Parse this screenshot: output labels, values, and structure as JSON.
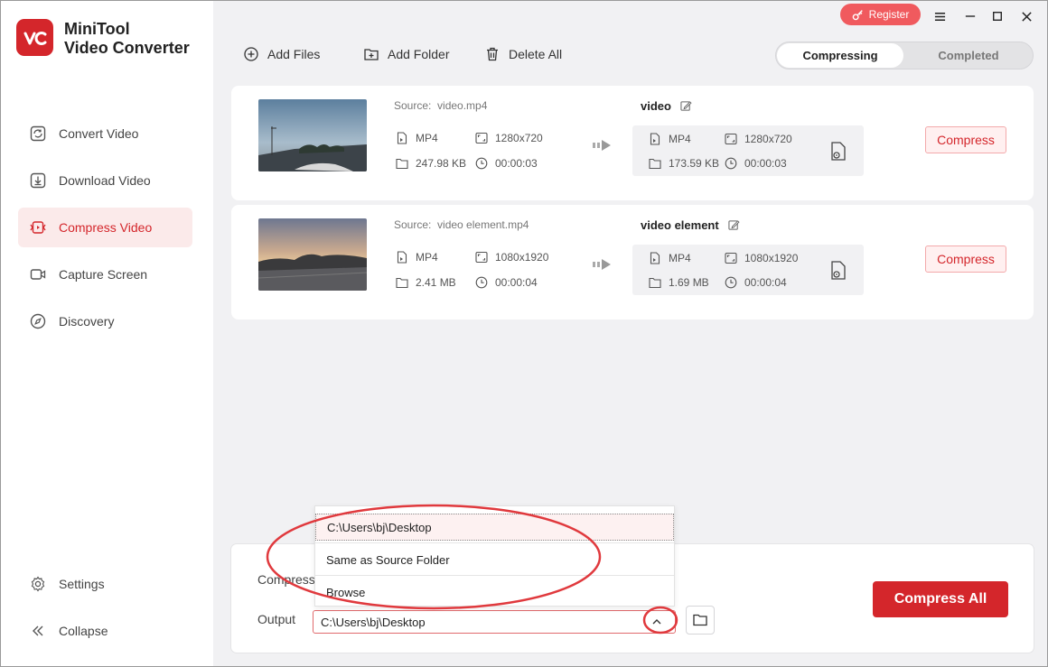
{
  "app": {
    "name_line1": "MiniTool",
    "name_line2": "Video Converter",
    "brand_color": "#d4262b"
  },
  "titlebar": {
    "register_label": "Register"
  },
  "sidebar": {
    "items": [
      {
        "label": "Convert Video",
        "icon": "convert-icon"
      },
      {
        "label": "Download Video",
        "icon": "download-icon"
      },
      {
        "label": "Compress Video",
        "icon": "compress-icon",
        "active": true
      },
      {
        "label": "Capture Screen",
        "icon": "camera-icon"
      },
      {
        "label": "Discovery",
        "icon": "compass-icon"
      }
    ],
    "settings_label": "Settings",
    "collapse_label": "Collapse"
  },
  "toolbar": {
    "add_files": "Add Files",
    "add_folder": "Add Folder",
    "delete_all": "Delete All"
  },
  "tabs": {
    "compressing": "Compressing",
    "completed": "Completed"
  },
  "files": [
    {
      "source_label": "Source:",
      "source_name": "video.mp4",
      "format": "MP4",
      "resolution": "1280x720",
      "size": "247.98 KB",
      "duration": "00:00:03",
      "output_name": "video",
      "out_format": "MP4",
      "out_resolution": "1280x720",
      "out_size": "173.59 KB",
      "out_duration": "00:00:03",
      "button": "Compress"
    },
    {
      "source_label": "Source:",
      "source_name": "video element.mp4",
      "format": "MP4",
      "resolution": "1080x1920",
      "size": "2.41 MB",
      "duration": "00:00:04",
      "output_name": "video element",
      "out_format": "MP4",
      "out_resolution": "1080x1920",
      "out_size": "1.69 MB",
      "out_duration": "00:00:04",
      "button": "Compress"
    }
  ],
  "bottom": {
    "compress_label": "Compress",
    "output_label": "Output",
    "output_value": "C:\\Users\\bj\\Desktop",
    "compress_all": "Compress All"
  },
  "dropdown": {
    "options": [
      "C:\\Users\\bj\\Desktop",
      "Same as Source Folder",
      "Browse"
    ]
  }
}
